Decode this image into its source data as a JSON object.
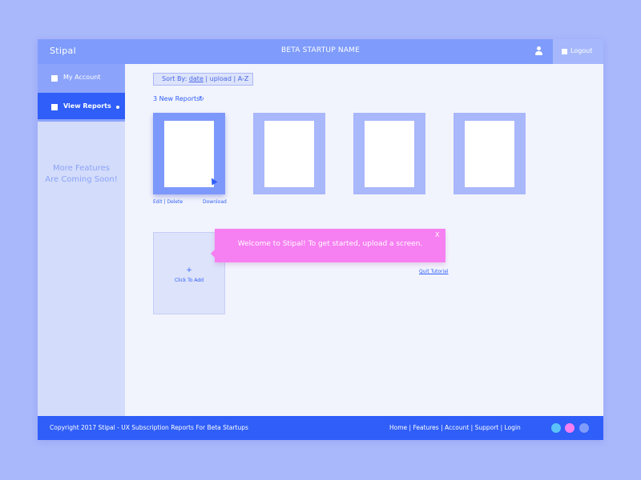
{
  "header": {
    "brand": "Stipal",
    "title": "BETA STARTUP NAME",
    "logout_label": "Logout"
  },
  "sidebar": {
    "items": [
      {
        "label": "My Account"
      },
      {
        "label": "View Reports"
      }
    ],
    "coming_soon_line1": "More Features",
    "coming_soon_line2": "Are Coming Soon!"
  },
  "main": {
    "sort": {
      "label": "Sort By:",
      "option_date": "date",
      "sep1": " | ",
      "option_upload": "upload",
      "sep2": " | ",
      "option_az": "A-Z"
    },
    "new_reports": "3 New Reports!",
    "card_actions": {
      "edit_delete": "Edit | Delete",
      "download": "Download"
    },
    "add_card": {
      "plus": "+",
      "label": "Click To Add"
    },
    "toast": {
      "message": "Welcome to Stipal! To get started, upload a screen.",
      "close": "X"
    },
    "quit_tutorial": "Quit Tutorial"
  },
  "footer": {
    "copyright": "Copyright 2017 Stipal - UX Subscription Reports For Beta Startups",
    "links": [
      "Home",
      "Features",
      "Account",
      "Support",
      "Login"
    ],
    "link_sep": " | ",
    "circle_colors": [
      "#5bc2f9",
      "#f67ff1",
      "#7f9cfc"
    ]
  },
  "colors": {
    "primary": "#2f5ef8",
    "secondary": "#7f9cfc",
    "accent_pink": "#f67ff1",
    "background": "#a9b7fb"
  }
}
